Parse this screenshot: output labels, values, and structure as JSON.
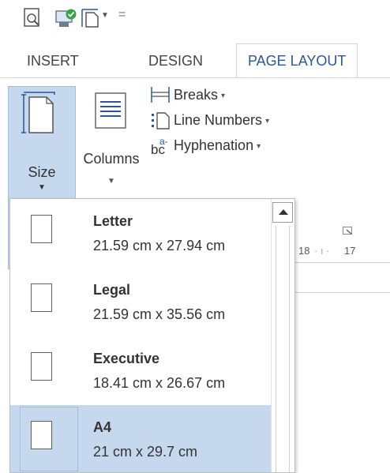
{
  "qat": {
    "print_preview_icon": "print-preview-icon",
    "save_icon": "save-check-icon",
    "page_icon": "page-size-icon",
    "customize_glyph": "="
  },
  "tabs": [
    {
      "label": "INSERT"
    },
    {
      "label": "DESIGN"
    },
    {
      "label": "PAGE LAYOUT",
      "active": true
    }
  ],
  "ribbon": {
    "size": {
      "label": "Size",
      "caret": "▼"
    },
    "columns": {
      "label": "Columns",
      "caret": "▼"
    },
    "breaks": {
      "label": "Breaks",
      "caret": "▾"
    },
    "line_numbers": {
      "label": "Line Numbers",
      "caret": "▾"
    },
    "hyphenation": {
      "label": "Hyphenation",
      "caret": "▾"
    }
  },
  "ruler": {
    "marks": [
      "18",
      "17"
    ]
  },
  "size_menu": {
    "items": [
      {
        "name": "Letter",
        "dims": "21.59 cm x 27.94 cm",
        "selected": false
      },
      {
        "name": "Legal",
        "dims": "21.59 cm x 35.56 cm",
        "selected": false
      },
      {
        "name": "Executive",
        "dims": "18.41 cm x 26.67 cm",
        "selected": false
      },
      {
        "name": "A4",
        "dims": "21 cm x 29.7 cm",
        "selected": true
      }
    ]
  },
  "colors": {
    "accent": "#2b579a",
    "selection": "#c5d8ee",
    "selection_border": "#9ebde6"
  }
}
